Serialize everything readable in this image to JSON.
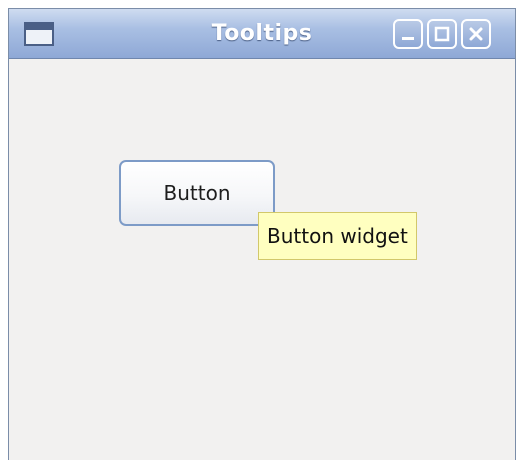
{
  "window": {
    "title": "Tooltips",
    "icons": {
      "app": "window-icon",
      "minimize": "minimize-icon",
      "maximize": "maximize-icon",
      "close": "close-icon"
    }
  },
  "main": {
    "button_label": "Button",
    "tooltip_text": "Button widget"
  },
  "colors": {
    "titlebar": "#8ea8d6",
    "background": "#f2f1f0",
    "tooltip_background": "#ffffc0",
    "button_border": "#7d9bc7"
  }
}
